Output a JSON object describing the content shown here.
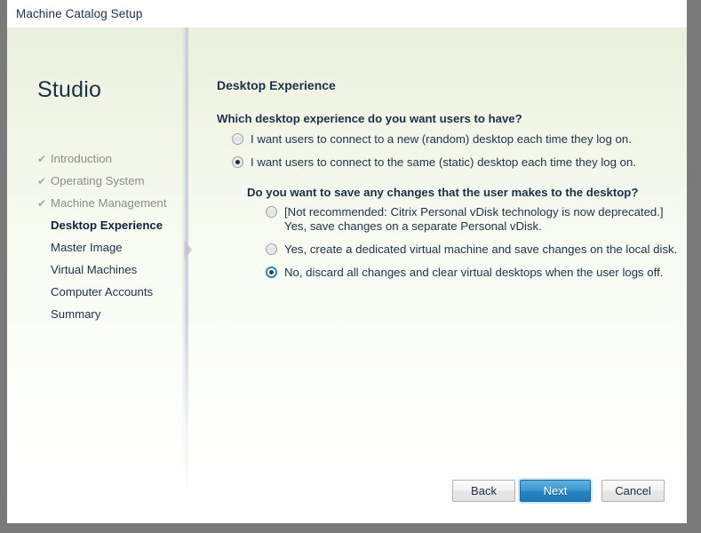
{
  "window": {
    "title": "Machine Catalog Setup"
  },
  "sidebar": {
    "brand": "Studio",
    "check_glyph": "✔",
    "items": [
      {
        "label": "Introduction",
        "state": "done"
      },
      {
        "label": "Operating System",
        "state": "done"
      },
      {
        "label": "Machine Management",
        "state": "done"
      },
      {
        "label": "Desktop Experience",
        "state": "current"
      },
      {
        "label": "Master Image",
        "state": "pending"
      },
      {
        "label": "Virtual Machines",
        "state": "pending"
      },
      {
        "label": "Computer Accounts",
        "state": "pending"
      },
      {
        "label": "Summary",
        "state": "pending"
      }
    ]
  },
  "main": {
    "page_title": "Desktop Experience",
    "question1": "Which desktop experience do you want users to have?",
    "options1": [
      {
        "label": "I want users to connect to a new (random) desktop each time they log on.",
        "checked": false,
        "focused": false
      },
      {
        "label": "I want users to connect to the same (static) desktop each time they log on.",
        "checked": true,
        "focused": false
      }
    ],
    "question2": "Do you want to save any changes that the user makes to the desktop?",
    "options2": [
      {
        "label": "[Not recommended: Citrix Personal vDisk technology is now deprecated.]",
        "label_line2": "Yes, save changes on a separate Personal vDisk.",
        "checked": false,
        "focused": false
      },
      {
        "label": "Yes, create a dedicated virtual machine and save changes on the local disk.",
        "checked": false,
        "focused": false
      },
      {
        "label": "No, discard all changes and clear virtual desktops when the user logs off.",
        "checked": true,
        "focused": true
      }
    ]
  },
  "footer": {
    "back_label": "Back",
    "next_label": "Next",
    "cancel_label": "Cancel"
  },
  "colors": {
    "accent_blue": "#2583c2",
    "title_text": "#1d2f4a",
    "window_border": "#7a7a7a",
    "done_step": "#8c8c8c",
    "pointer": "#c9ced9"
  }
}
